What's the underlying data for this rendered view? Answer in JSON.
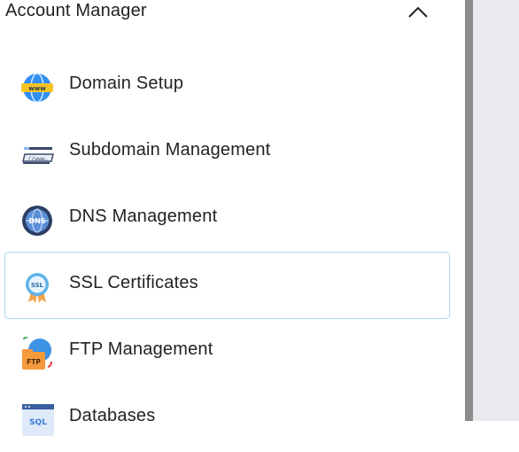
{
  "header": {
    "title": "Account Manager",
    "collapse_icon": "chevron-up-icon"
  },
  "menu": {
    "items": [
      {
        "label": "Domain Setup",
        "icon": "globe-www-icon"
      },
      {
        "label": "Subdomain Management",
        "icon": "www-link-icon"
      },
      {
        "label": "DNS Management",
        "icon": "dns-globe-icon"
      },
      {
        "label": "SSL Certificates",
        "icon": "ssl-badge-icon",
        "selected": true
      },
      {
        "label": "FTP Management",
        "icon": "ftp-folder-icon"
      },
      {
        "label": "Databases",
        "icon": "sql-database-icon"
      }
    ]
  },
  "colors": {
    "selected_border": "#a9d9ec",
    "divider": "#8b8b8b",
    "right_background": "#e9e9ee"
  }
}
